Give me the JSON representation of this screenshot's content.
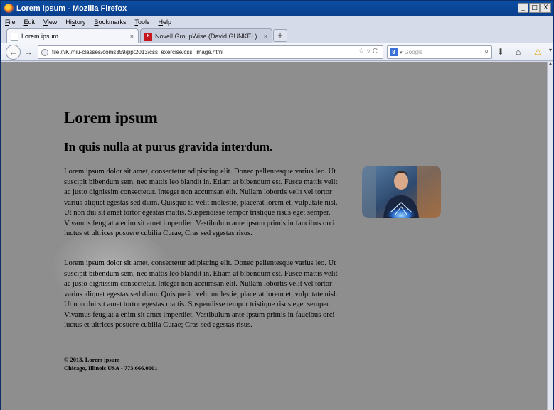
{
  "window": {
    "title": "Lorem ipsum - Mozilla Firefox",
    "controls": [
      "_",
      "□",
      "X"
    ]
  },
  "menu": [
    "File",
    "Edit",
    "View",
    "History",
    "Bookmarks",
    "Tools",
    "Help"
  ],
  "menu_access_keys": [
    "F",
    "E",
    "V",
    "s",
    "B",
    "T",
    "H"
  ],
  "tabs": [
    {
      "label": "Lorem ipsum",
      "close": "×",
      "active": true,
      "icon": "page-icon"
    },
    {
      "label": "Novell GroupWise (David GUNKEL)",
      "close": "×",
      "active": false,
      "icon": "novell-icon"
    }
  ],
  "new_tab_label": "+",
  "navigation": {
    "url": "file:///K:/niu-classes/coms359/ppt2013/css_exercise/css_image.html",
    "search_placeholder": "Google",
    "search_engine_letter": "8"
  },
  "page": {
    "heading": "Lorem ipsum",
    "subheading": "In quis nulla at purus gravida interdum.",
    "paragraphs": [
      "Lorem ipsum dolor sit amet, consectetur adipiscing elit. Donec pellentesque varius leo. Ut suscipit bibendum sem, nec mattis leo blandit in. Etiam at bibendum est. Fusce mattis velit ac justo dignissim consectetur. Integer non accumsan elit. Nullam lobortis velit vel tortor varius aliquet egestas sed diam. Quisque id velit molestie, placerat lorem et, vulputate nisl. Ut non dui sit amet tortor egestas mattis. Suspendisse tempor tristique risus eget semper. Vivamus feugiat a enim sit amet imperdiet. Vestibulum ante ipsum primis in faucibus orci luctus et ultrices posuere cubilia Curae; Cras sed egestas risus.",
      "Lorem ipsum dolor sit amet, consectetur adipiscing elit. Donec pellentesque varius leo. Ut suscipit bibendum sem, nec mattis leo blandit in. Etiam at bibendum est. Fusce mattis velit ac justo dignissim consectetur. Integer non accumsan elit. Nullam lobortis velit vel tortor varius aliquet egestas sed diam. Quisque id velit molestie, placerat lorem et, vulputate nisl. Ut non dui sit amet tortor egestas mattis. Suspendisse tempor tristique risus eget semper. Vivamus feugiat a enim sit amet imperdiet. Vestibulum ante ipsum primis in faucibus orci luctus et ultrices posuere cubilia Curae; Cras sed egestas risus."
    ],
    "footer_line1": "© 2013, Lorem ipsum",
    "footer_line2": "Chicago, Illinois USA - 773.666.0001"
  },
  "colors": {
    "page_background": "#8e8e8e",
    "titlebar": "#0c4ea3",
    "chrome": "#d6dbe9"
  }
}
